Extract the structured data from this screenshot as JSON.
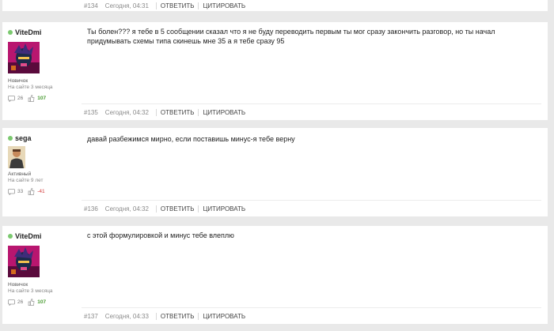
{
  "top_footer": {
    "num": "#134",
    "date": "Сегодня, 04:31",
    "reply": "ОТВЕТИТЬ",
    "quote": "ЦИТИРОВАТЬ"
  },
  "posts": [
    {
      "username": "ViteDmi",
      "role": "Новичок",
      "since": "На сайте 3 месяца",
      "comments": "26",
      "reputation": "107",
      "text": "Ты болен???  я тебе в 5 сообщении сказал что я не буду переводить первым ты мог сразу закончить разговор, но ты начал придумывать схемы типа скинешь мне 35 а я тебе сразу 95",
      "num": "#135",
      "date": "Сегодня, 04:32",
      "reply": "ОТВЕТИТЬ",
      "quote": "ЦИТИРОВАТЬ"
    },
    {
      "username": "sega",
      "role": "Активный",
      "since": "На сайте 9 лет",
      "comments": "33",
      "reputation": "-41",
      "text": "давай разбежимся мирно, если поставишь минус-я тебе верну",
      "num": "#136",
      "date": "Сегодня, 04:32",
      "reply": "ОТВЕТИТЬ",
      "quote": "ЦИТИРОВАТЬ"
    },
    {
      "username": "ViteDmi",
      "role": "Новичок",
      "since": "На сайте 3 месяца",
      "comments": "26",
      "reputation": "107",
      "text": "с этой формулировкой и минус тебе влеплю",
      "num": "#137",
      "date": "Сегодня, 04:33",
      "reply": "ОТВЕТИТЬ",
      "quote": "ЦИТИРОВАТЬ"
    }
  ],
  "colors": {
    "online": "#7bc96f",
    "rep_positive": "#4a9b32",
    "rep_negative": "#d33a3a"
  },
  "icons": {
    "comments": "speech-bubble-icon",
    "reputation": "thumbs-icon"
  }
}
